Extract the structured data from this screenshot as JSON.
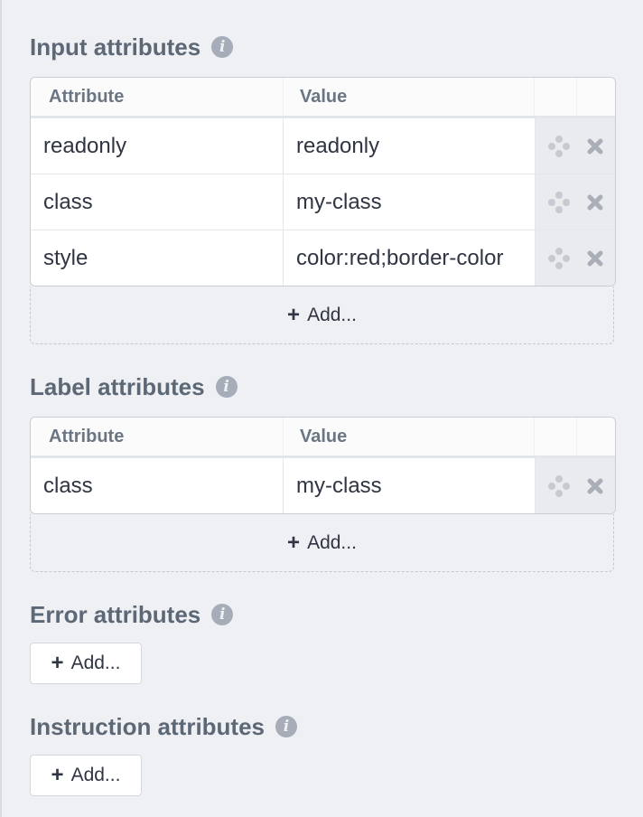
{
  "input_attributes": {
    "title": "Input attributes",
    "columns": {
      "attribute": "Attribute",
      "value": "Value"
    },
    "rows": [
      {
        "attribute": "readonly",
        "value": "readonly"
      },
      {
        "attribute": "class",
        "value": "my-class"
      },
      {
        "attribute": "style",
        "value": "color:red;border-color"
      }
    ],
    "add_label": "Add..."
  },
  "label_attributes": {
    "title": "Label attributes",
    "columns": {
      "attribute": "Attribute",
      "value": "Value"
    },
    "rows": [
      {
        "attribute": "class",
        "value": "my-class"
      }
    ],
    "add_label": "Add..."
  },
  "error_attributes": {
    "title": "Error attributes",
    "add_label": "Add..."
  },
  "instruction_attributes": {
    "title": "Instruction attributes",
    "add_label": "Add..."
  },
  "icons": {
    "info": "info-icon",
    "move": "move-icon",
    "remove": "remove-icon",
    "plus": "plus-icon"
  },
  "colors": {
    "background": "#eff0f3",
    "heading": "#5d6877",
    "action_cell": "#e9ebee",
    "text": "#2f3542"
  }
}
